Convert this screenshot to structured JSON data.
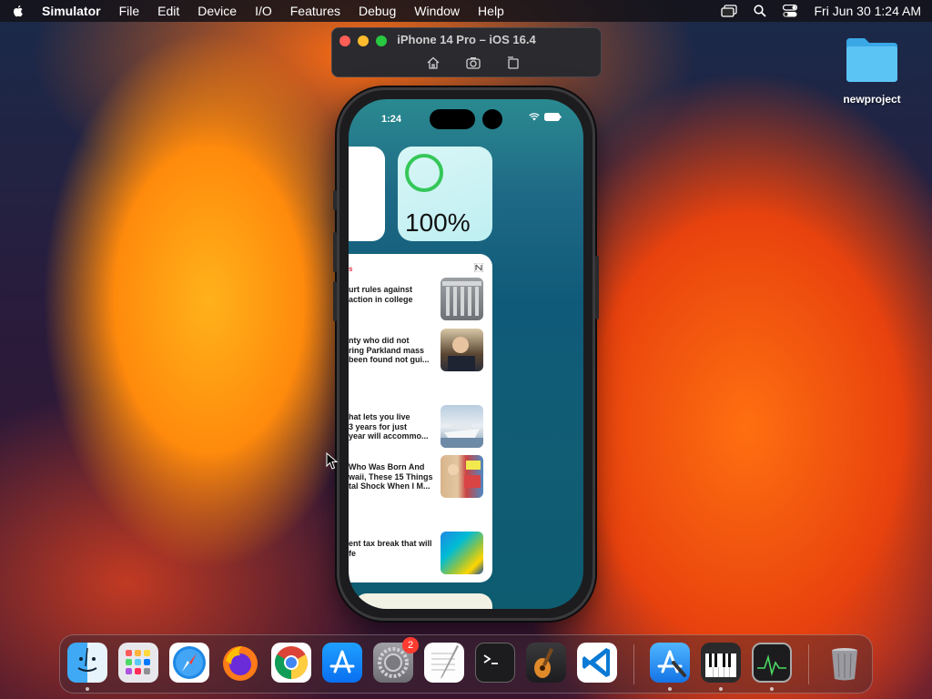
{
  "menubar": {
    "items": [
      "Simulator",
      "File",
      "Edit",
      "Device",
      "I/O",
      "Features",
      "Debug",
      "Window",
      "Help"
    ],
    "clock": "Fri Jun 30  1:24 AM"
  },
  "simulator_window": {
    "title": "iPhone 14 Pro – iOS 16.4",
    "tools": [
      "home-icon",
      "screenshot-icon",
      "rotate-icon"
    ]
  },
  "desktop": {
    "folder_label": "newproject"
  },
  "phone": {
    "status_time": "1:24",
    "battery_widget": {
      "percent": "100%",
      "level": 1.0,
      "ring_color": "#34c759"
    },
    "news_widget": {
      "header_fragment": "s",
      "items": [
        {
          "headline": "urt rules against\naction in college",
          "thumb": "court"
        },
        {
          "headline": "nty who did not\nring Parkland mass\n been found not gui...",
          "thumb": "man"
        },
        {
          "headline": "hat lets you live\n3 years for just\nyear will accommo...",
          "thumb": "ship"
        },
        {
          "headline": " Who Was Born And\nwaii, These 15 Things\ntal Shock When I M...",
          "thumb": "hawaii"
        },
        {
          "headline": "ent tax break that will\nfe",
          "thumb": "tax"
        }
      ]
    }
  },
  "dock": {
    "apps": [
      {
        "name": "Finder",
        "icon": "finder-icon",
        "running": true
      },
      {
        "name": "Launchpad",
        "icon": "launchpad-icon",
        "running": false
      },
      {
        "name": "Safari",
        "icon": "safari-icon",
        "running": false
      },
      {
        "name": "Firefox",
        "icon": "firefox-icon",
        "running": false
      },
      {
        "name": "Chrome",
        "icon": "chrome-icon",
        "running": false
      },
      {
        "name": "App Store",
        "icon": "app-store-icon",
        "running": false
      },
      {
        "name": "System Settings",
        "icon": "settings-icon",
        "running": false,
        "badge": "2"
      },
      {
        "name": "TextEdit",
        "icon": "textedit-icon",
        "running": false
      },
      {
        "name": "Terminal",
        "icon": "terminal-icon",
        "running": false
      },
      {
        "name": "GarageBand",
        "icon": "garageband-icon",
        "running": false
      },
      {
        "name": "Visual Studio Code",
        "icon": "vscode-icon",
        "running": false
      },
      {
        "name": "Xcode",
        "icon": "xcode-icon",
        "running": true
      },
      {
        "name": "Piano",
        "icon": "piano-icon",
        "running": true
      },
      {
        "name": "Activity Monitor",
        "icon": "activity-monitor-icon",
        "running": true
      },
      {
        "name": "Trash",
        "icon": "trash-icon",
        "running": false
      }
    ]
  },
  "colors": {
    "menubar_bg": "#141218",
    "accent_green": "#34c759",
    "news_red": "#e5324b"
  }
}
